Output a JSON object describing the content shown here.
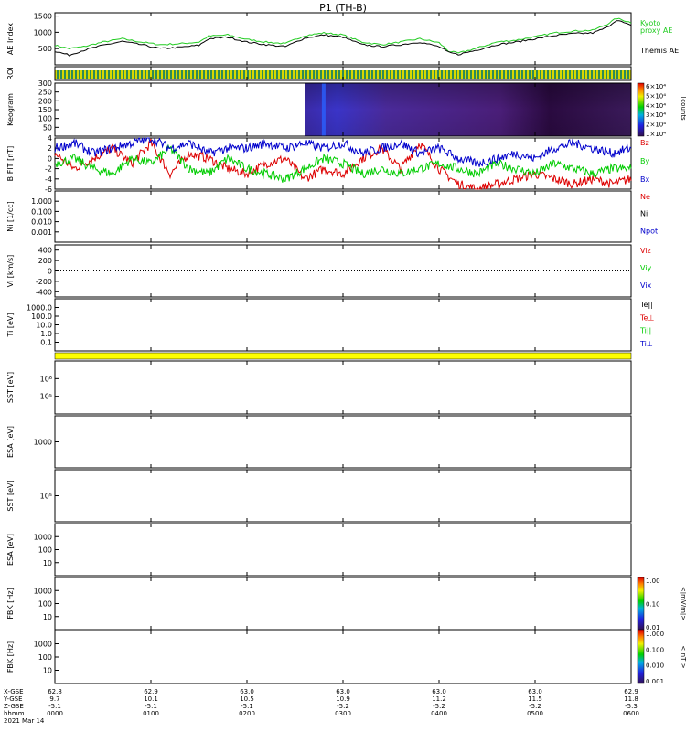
{
  "title": "P1  (TH-B)",
  "colors": {
    "kyoto": "#22cc22",
    "themis": "#000000",
    "red": "#dd0000",
    "green": "#00cc00",
    "blue": "#0000cc",
    "roi_yellow": "#d8d800",
    "roi_green": "#2e8b57",
    "esa_band": "#ffff00"
  },
  "footer": {
    "row_labels": [
      "X-GSE",
      "Y-GSE",
      "Z-GSE",
      "hhmm",
      "2021 Mar 14"
    ],
    "ticks": [
      {
        "x": "62.8",
        "y": "9.7",
        "z": "-5.1",
        "t": "0000"
      },
      {
        "x": "62.9",
        "y": "10.1",
        "z": "-5.1",
        "t": "0100"
      },
      {
        "x": "63.0",
        "y": "10.5",
        "z": "-5.1",
        "t": "0200"
      },
      {
        "x": "63.0",
        "y": "10.9",
        "z": "-5.2",
        "t": "0300"
      },
      {
        "x": "63.0",
        "y": "11.2",
        "z": "-5.2",
        "t": "0400"
      },
      {
        "x": "63.0",
        "y": "11.5",
        "z": "-5.2",
        "t": "0500"
      },
      {
        "x": "62.9",
        "y": "11.8",
        "z": "-5.3",
        "t": "0600"
      }
    ]
  },
  "chart_data": [
    {
      "type": "line",
      "panel": "ae",
      "ylabel": "AE Index",
      "yticks": [
        "500",
        "1000",
        "1500"
      ],
      "ylim": [
        0,
        1600
      ],
      "x_hours": [
        0,
        0.15,
        0.3,
        0.5,
        0.7,
        0.9,
        1.1,
        1.3,
        1.5,
        1.6,
        1.8,
        2.0,
        2.2,
        2.4,
        2.6,
        2.8,
        3.0,
        3.2,
        3.4,
        3.6,
        3.8,
        4.0,
        4.1,
        4.2,
        4.4,
        4.6,
        4.8,
        5.0,
        5.2,
        5.4,
        5.6,
        5.75,
        5.85,
        6.0
      ],
      "series": [
        {
          "name": "Kyoto proxy AE",
          "color_key": "kyoto",
          "values": [
            600,
            500,
            560,
            700,
            800,
            700,
            620,
            650,
            700,
            880,
            920,
            780,
            700,
            650,
            900,
            980,
            920,
            700,
            620,
            700,
            800,
            680,
            420,
            360,
            520,
            700,
            760,
            860,
            980,
            1040,
            1060,
            1250,
            1430,
            1300
          ]
        },
        {
          "name": "Themis AE",
          "color_key": "themis",
          "values": [
            420,
            300,
            450,
            600,
            720,
            620,
            500,
            540,
            600,
            800,
            850,
            700,
            620,
            560,
            820,
            920,
            850,
            620,
            560,
            620,
            700,
            560,
            380,
            320,
            460,
            620,
            700,
            800,
            900,
            960,
            980,
            1150,
            1380,
            1200
          ]
        }
      ]
    },
    {
      "type": "table",
      "panel": "roi",
      "ylabel": "ROI"
    },
    {
      "type": "heatmap",
      "panel": "keogram",
      "ylabel": "Keogram",
      "yticks": [
        "50",
        "100",
        "150",
        "200",
        "250",
        "300"
      ],
      "ylim": [
        0,
        300
      ],
      "data_start_hour": 2.6,
      "data_end_hour": 6.0,
      "colorbar": {
        "label": "[counts]",
        "ticks": [
          "1×10⁴",
          "2×10⁴",
          "3×10⁴",
          "4×10⁴",
          "5×10⁴",
          "6×10⁴"
        ]
      }
    },
    {
      "type": "line",
      "panel": "bfield",
      "ylabel": "B FIT [nT]",
      "yticks": [
        "-6",
        "-4",
        "-2",
        "0",
        "2",
        "4"
      ],
      "ylim": [
        -6,
        4
      ],
      "x_hours": [
        0,
        0.2,
        0.4,
        0.6,
        0.8,
        1.0,
        1.2,
        1.4,
        1.6,
        1.8,
        2.0,
        2.2,
        2.4,
        2.6,
        2.8,
        3.0,
        3.2,
        3.4,
        3.6,
        3.8,
        4.0,
        4.2,
        4.4,
        4.6,
        4.8,
        5.0,
        5.2,
        5.4,
        5.6,
        5.8,
        6.0
      ],
      "series": [
        {
          "name": "Bz",
          "color_key": "red",
          "values": [
            1,
            -2,
            0,
            2,
            -1,
            3,
            -3,
            1,
            0,
            -2,
            -3,
            -1,
            0,
            -4,
            -2,
            -3,
            0,
            2,
            -2,
            3,
            -2,
            -5,
            -6,
            -5,
            -4,
            -3,
            -4,
            -5,
            -4,
            -5,
            -4
          ]
        },
        {
          "name": "By",
          "color_key": "green",
          "values": [
            -1,
            0,
            -2,
            -3,
            0,
            -1,
            2,
            -2,
            -3,
            0,
            -2,
            -3,
            -4,
            -2,
            0,
            -1,
            -3,
            -2,
            -3,
            -2,
            -1,
            -2,
            -3,
            -1,
            -2,
            -3,
            -1,
            -2,
            -3,
            -2,
            -2
          ]
        },
        {
          "name": "Bx",
          "color_key": "blue",
          "values": [
            2,
            3,
            1,
            2,
            3,
            4,
            2,
            3,
            1,
            2,
            2,
            3,
            2,
            3,
            2,
            3,
            1,
            2,
            3,
            1,
            2,
            0,
            -1,
            0,
            1,
            0,
            2,
            3,
            2,
            1,
            2
          ]
        }
      ]
    },
    {
      "type": "line",
      "panel": "density",
      "ylabel": "Ni [1/cc]",
      "yticks": [
        "0.001",
        "0.010",
        "0.100",
        "1.000"
      ],
      "legend": [
        "Ne",
        "Ni",
        "Npot"
      ],
      "legend_colors": [
        "red",
        "themis",
        "blue"
      ]
    },
    {
      "type": "line",
      "panel": "velocity",
      "ylabel": "Vi [km/s]",
      "yticks": [
        "-400",
        "-200",
        "0",
        "200",
        "400"
      ],
      "ylim": [
        -500,
        500
      ],
      "legend": [
        "Viz",
        "Viy",
        "Vix"
      ],
      "legend_colors": [
        "red",
        "green",
        "blue"
      ]
    },
    {
      "type": "line",
      "panel": "temperature",
      "ylabel": "Ti [eV]",
      "yticks": [
        "0.1",
        "1.0",
        "10.0",
        "100.0",
        "1000.0"
      ],
      "legend": [
        "Te||",
        "Te⊥",
        "Ti||",
        "Ti⊥"
      ],
      "legend_colors": [
        "themis",
        "red",
        "green",
        "blue"
      ]
    },
    {
      "type": "heatmap",
      "panel": "sst_eflux",
      "ylabel": "SST [eV]",
      "yticks": [
        "10⁵",
        "10⁶"
      ]
    },
    {
      "type": "heatmap",
      "panel": "esa_eflux",
      "ylabel": "ESA [eV]",
      "yticks": [
        "1000"
      ]
    },
    {
      "type": "heatmap",
      "panel": "sst_e",
      "ylabel": "SST [eV]",
      "yticks": [
        "10⁵"
      ]
    },
    {
      "type": "heatmap",
      "panel": "esa_e",
      "ylabel": "ESA [eV]",
      "yticks": [
        "10",
        "100",
        "1000"
      ]
    },
    {
      "type": "heatmap",
      "panel": "fbk_e",
      "ylabel": "FBK [Hz]",
      "yticks": [
        "10",
        "100",
        "1000"
      ],
      "colorbar": {
        "label": "<|mV/m|>",
        "ticks": [
          "0.01",
          "0.10",
          "1.00"
        ]
      }
    },
    {
      "type": "heatmap",
      "panel": "fbk_b",
      "ylabel": "FBK [Hz]",
      "yticks": [
        "10",
        "100",
        "1000"
      ],
      "colorbar": {
        "label": "<|nT|>",
        "ticks": [
          "0.001",
          "0.010",
          "0.100",
          "1.000"
        ]
      }
    }
  ]
}
